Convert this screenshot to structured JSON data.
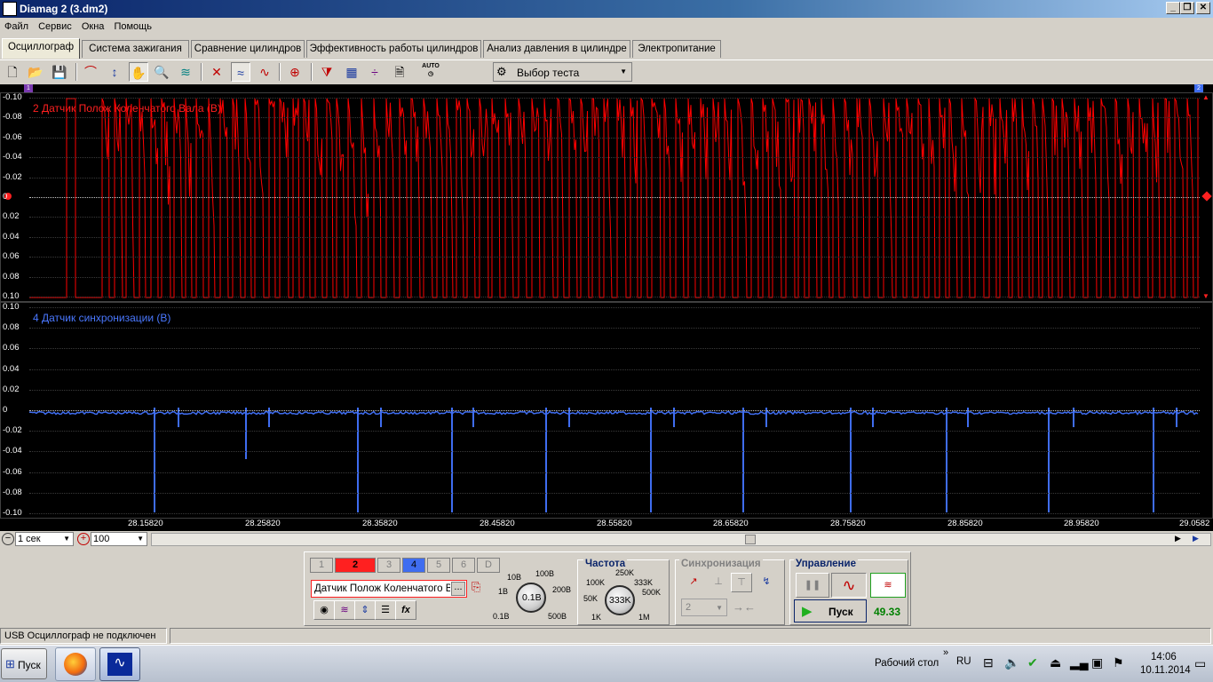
{
  "window": {
    "title": "Diamag 2 (3.dm2)"
  },
  "menu": [
    "Файл",
    "Сервис",
    "Окна",
    "Помощь"
  ],
  "tabs": [
    "Осциллограф",
    "Система зажигания",
    "Сравнение цилиндров",
    "Эффективность работы цилиндров",
    "Анализ давления в цилиндре",
    "Электропитание"
  ],
  "toolbar": {
    "test_select": "Выбор теста",
    "auto": "AUTO"
  },
  "channel_top": {
    "label": "2 Датчик Полож Коленчатого Вала (В)",
    "color": "#ff0000",
    "ticks": [
      "-0.10",
      "-0.08",
      "-0.06",
      "-0.04",
      "-0.02",
      "0",
      "0.02",
      "0.04",
      "0.06",
      "0.08",
      "0.10"
    ],
    "marker_left": "1",
    "marker_right": "2"
  },
  "channel_bottom": {
    "label": "4 Датчик синхронизации (В)",
    "color": "#3f6df0",
    "ticks": [
      "0.10",
      "0.08",
      "0.06",
      "0.04",
      "0.02",
      "0",
      "-0.02",
      "-0.04",
      "-0.06",
      "-0.08",
      "-0.10"
    ]
  },
  "x_axis": {
    "ticks": [
      "28.15820",
      "28.25820",
      "28.35820",
      "28.45820",
      "28.55820",
      "28.65820",
      "28.75820",
      "28.85820",
      "28.95820",
      "29.0582"
    ]
  },
  "timebase": {
    "value": "1 сек",
    "zoom": "100"
  },
  "channels": {
    "buttons": [
      "1",
      "2",
      "3",
      "4",
      "5",
      "6",
      "D"
    ],
    "selected_name": "Датчик Полож Коленчатого Ва",
    "more": "..."
  },
  "voltage": {
    "value": "0.1В",
    "labels": [
      "10В",
      "100В",
      "1В",
      "200В",
      "0.1В",
      "500В"
    ]
  },
  "frequency": {
    "title": "Частота",
    "value": "333K",
    "labels": [
      "250K",
      "100K",
      "333K",
      "50K",
      "500K",
      "1K",
      "1M"
    ]
  },
  "sync": {
    "title": "Синхронизация",
    "channel": "2"
  },
  "control": {
    "title": "Управление",
    "start": "Пуск",
    "fps": "49.33"
  },
  "status": {
    "text": "USB Осциллограф не подключен"
  },
  "taskbar": {
    "start": "Пуск",
    "desktop": "Рабочий стол",
    "lang": "RU",
    "time": "14:06",
    "date": "10.11.2014"
  }
}
